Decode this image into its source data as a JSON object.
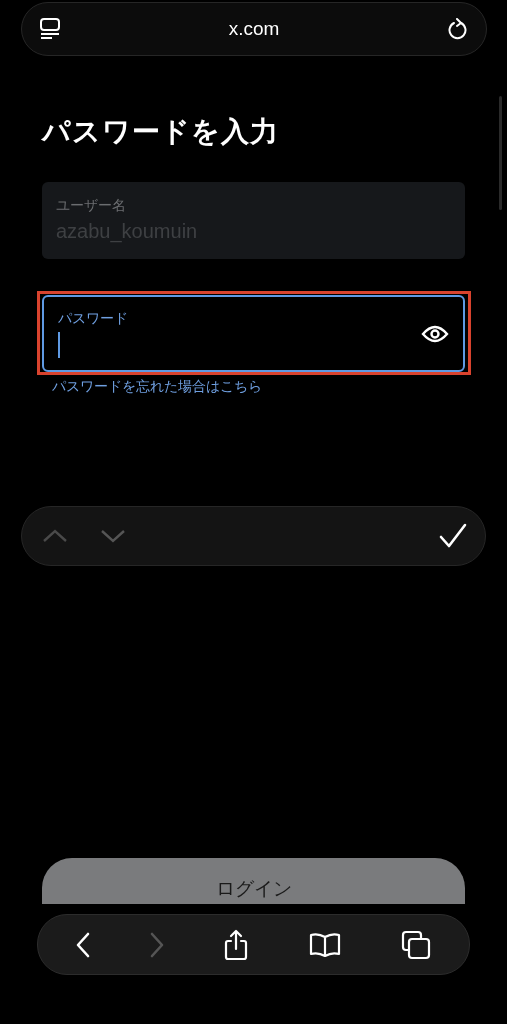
{
  "address_bar": {
    "url": "x.com"
  },
  "title": "パスワードを入力",
  "fields": [
    {
      "kind": "text",
      "label": "ユーザー名",
      "value": "azabu_koumuin",
      "disabled": true,
      "focused": false,
      "highlighted": false
    },
    {
      "kind": "password",
      "label": "パスワード",
      "disabled": false,
      "focused": true,
      "highlighted": true
    }
  ],
  "forgot_link": "パスワードを忘れた場合はこちら",
  "form_nav": {
    "previous_disabled": true,
    "next_disabled": true
  },
  "login_button": {
    "label": "ログイン",
    "disabled": true
  },
  "toolbar": [
    {
      "kind": "back",
      "disabled": false
    },
    {
      "kind": "forward",
      "disabled": true
    },
    {
      "kind": "share",
      "disabled": false
    },
    {
      "kind": "bookmarks",
      "disabled": false
    },
    {
      "kind": "tabs",
      "disabled": false
    }
  ]
}
